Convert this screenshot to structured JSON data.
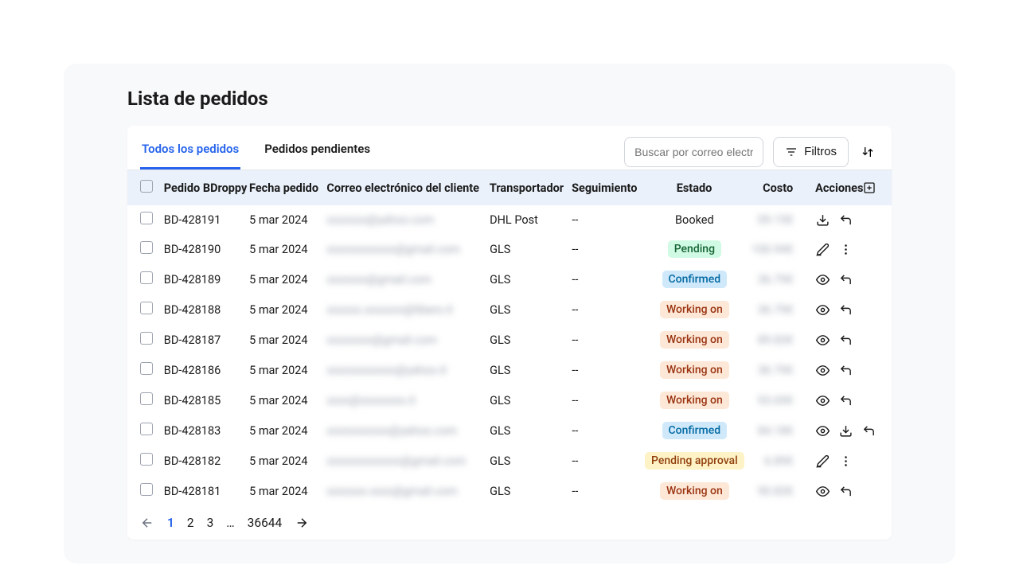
{
  "page_title": "Lista de pedidos",
  "tabs": [
    {
      "label": "Todos los pedidos",
      "active": true
    },
    {
      "label": "Pedidos pendientes",
      "active": false
    }
  ],
  "search_placeholder": "Buscar por correo electrónico",
  "filters_label": "Filtros",
  "columns": {
    "id": "Pedido BDroppy",
    "date": "Fecha pedido",
    "email": "Correo electrónico del cliente",
    "carrier": "Transportador",
    "tracking": "Seguimiento",
    "status": "Estado",
    "cost": "Costo",
    "actions": "Acciones"
  },
  "rows": [
    {
      "id": "BD-428191",
      "date": "5 mar 2024",
      "email": "xxxxxxx@yahoo.com",
      "carrier": "DHL Post",
      "tracking": "--",
      "status": "Booked",
      "status_style": "none",
      "cost": "09.15€",
      "actions": [
        "download",
        "undo"
      ]
    },
    {
      "id": "BD-428190",
      "date": "5 mar 2024",
      "email": "xxxxxxxxxxxx@gmail.com",
      "carrier": "GLS",
      "tracking": "--",
      "status": "Pending",
      "status_style": "green",
      "cost": "100.94€",
      "actions": [
        "edit",
        "more"
      ]
    },
    {
      "id": "BD-428189",
      "date": "5 mar 2024",
      "email": "xxxxxxx@gmail.com",
      "carrier": "GLS",
      "tracking": "--",
      "status": "Confirmed",
      "status_style": "blue",
      "cost": "36.79€",
      "actions": [
        "eye",
        "undo"
      ]
    },
    {
      "id": "BD-428188",
      "date": "5 mar 2024",
      "email": "xxxxxx.xxxxxxx@libero.it",
      "carrier": "GLS",
      "tracking": "--",
      "status": "Working on",
      "status_style": "orange",
      "cost": "36.79€",
      "actions": [
        "eye",
        "undo"
      ]
    },
    {
      "id": "BD-428187",
      "date": "5 mar 2024",
      "email": "xxxxxxxx@gmail.com",
      "carrier": "GLS",
      "tracking": "--",
      "status": "Working on",
      "status_style": "orange",
      "cost": "89.83€",
      "actions": [
        "eye",
        "undo"
      ]
    },
    {
      "id": "BD-428186",
      "date": "5 mar 2024",
      "email": "xxxxxxxxxxxx@yahoo.it",
      "carrier": "GLS",
      "tracking": "--",
      "status": "Working on",
      "status_style": "orange",
      "cost": "36.79€",
      "actions": [
        "eye",
        "undo"
      ]
    },
    {
      "id": "BD-428185",
      "date": "5 mar 2024",
      "email": "xxxx@xxxxxxxx.it",
      "carrier": "GLS",
      "tracking": "--",
      "status": "Working on",
      "status_style": "orange",
      "cost": "93.69€",
      "actions": [
        "eye",
        "undo"
      ]
    },
    {
      "id": "BD-428183",
      "date": "5 mar 2024",
      "email": "xxxxxxxxxxx@yahoo.com",
      "carrier": "GLS",
      "tracking": "--",
      "status": "Confirmed",
      "status_style": "blue",
      "cost": "84.18€",
      "actions": [
        "eye",
        "download",
        "undo"
      ]
    },
    {
      "id": "BD-428182",
      "date": "5 mar 2024",
      "email": "xxxxxxxxxxxxx@gmail.com",
      "carrier": "GLS",
      "tracking": "--",
      "status": "Pending approval",
      "status_style": "yellow",
      "cost": "6.89€",
      "actions": [
        "edit",
        "more"
      ]
    },
    {
      "id": "BD-428181",
      "date": "5 mar 2024",
      "email": "xxxxxxx.xxxx@gmail.com",
      "carrier": "GLS",
      "tracking": "--",
      "status": "Working on",
      "status_style": "orange",
      "cost": "90.83€",
      "actions": [
        "eye",
        "undo"
      ]
    }
  ],
  "pagination": {
    "current": "1",
    "pages": [
      "2",
      "3"
    ],
    "ellipsis": "…",
    "last": "36644"
  }
}
